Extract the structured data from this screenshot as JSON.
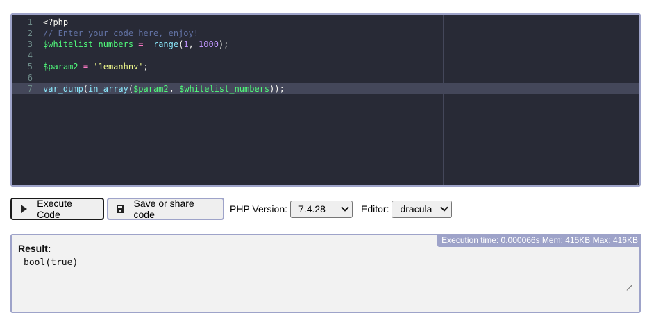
{
  "editor": {
    "line_numbers": [
      "1",
      "2",
      "3",
      "4",
      "5",
      "6",
      "7"
    ],
    "lines": [
      {
        "tokens": [
          {
            "type": "tag",
            "text": "<?php"
          }
        ]
      },
      {
        "tokens": [
          {
            "type": "comment",
            "text": "// Enter your code here, enjoy!"
          }
        ]
      },
      {
        "tokens": [
          {
            "type": "var",
            "text": "$whitelist_numbers"
          },
          {
            "type": "plain",
            "text": " "
          },
          {
            "type": "op",
            "text": "="
          },
          {
            "type": "plain",
            "text": "  "
          },
          {
            "type": "fn",
            "text": "range"
          },
          {
            "type": "plain",
            "text": "("
          },
          {
            "type": "num",
            "text": "1"
          },
          {
            "type": "plain",
            "text": ", "
          },
          {
            "type": "num",
            "text": "1000"
          },
          {
            "type": "plain",
            "text": ");"
          }
        ]
      },
      {
        "tokens": []
      },
      {
        "tokens": [
          {
            "type": "var",
            "text": "$param2"
          },
          {
            "type": "plain",
            "text": " "
          },
          {
            "type": "op",
            "text": "="
          },
          {
            "type": "plain",
            "text": " "
          },
          {
            "type": "str",
            "text": "'1emanhnv'"
          },
          {
            "type": "plain",
            "text": ";"
          }
        ]
      },
      {
        "tokens": []
      },
      {
        "tokens": [
          {
            "type": "fn",
            "text": "var_dump"
          },
          {
            "type": "plain",
            "text": "("
          },
          {
            "type": "fn",
            "text": "in_array"
          },
          {
            "type": "plain",
            "text": "("
          },
          {
            "type": "var",
            "text": "$param2"
          },
          {
            "type": "caret",
            "text": ""
          },
          {
            "type": "plain",
            "text": ", "
          },
          {
            "type": "var",
            "text": "$whitelist_numbers"
          },
          {
            "type": "plain",
            "text": "));"
          }
        ]
      }
    ],
    "active_line": 7,
    "theme_colors": {
      "background": "#282a36",
      "active_line": "#44475a",
      "comment": "#6272a4",
      "variable": "#50fa7b",
      "number": "#bd93f9",
      "string": "#f1fa8c",
      "function": "#8be9fd",
      "operator": "#ff79c6"
    }
  },
  "toolbar": {
    "execute_label": "Execute Code",
    "execute_icon": "play-icon",
    "save_label": "Save or share code",
    "save_icon": "floppy-disk-icon",
    "php_version_label": "PHP Version:",
    "php_version_value": "7.4.28",
    "editor_label": "Editor:",
    "editor_value": "dracula"
  },
  "result": {
    "title": "Result:",
    "output": "bool(true)",
    "execution_info": "Execution time: 0.000066s Mem: 415KB Max: 416KB"
  }
}
